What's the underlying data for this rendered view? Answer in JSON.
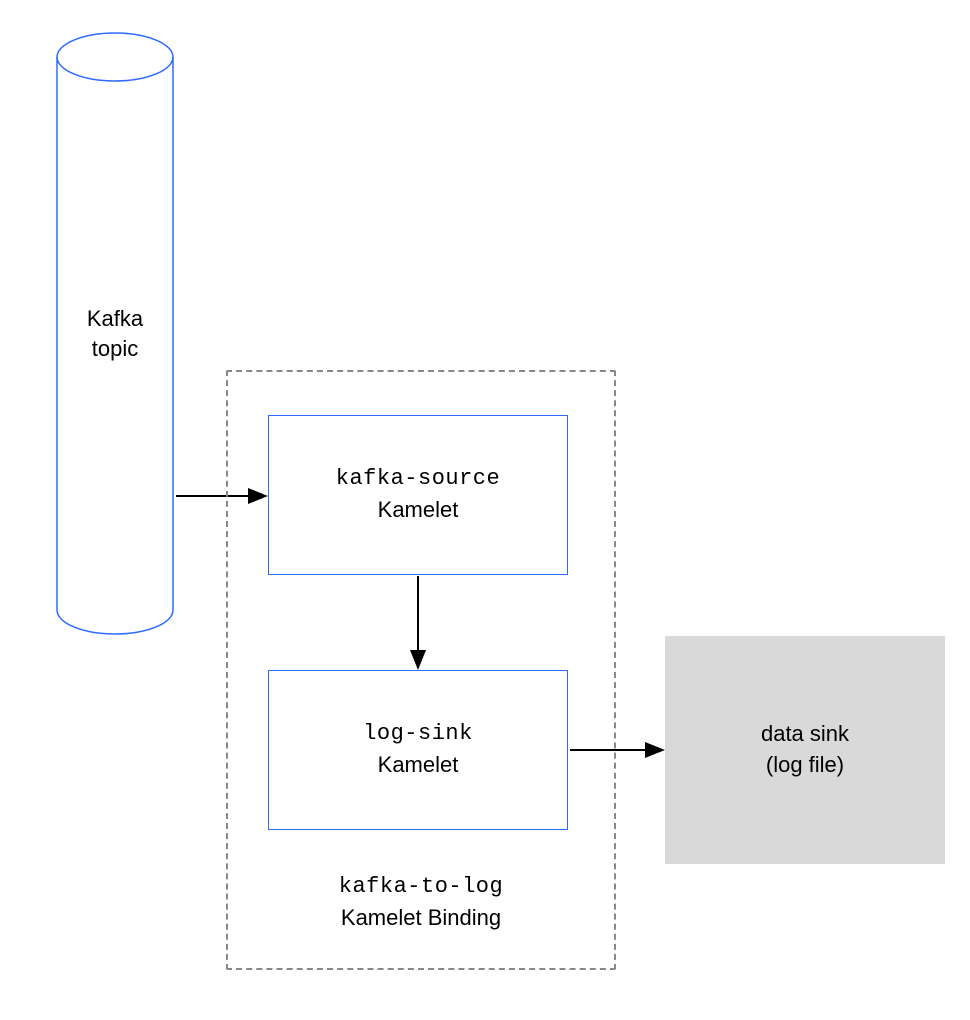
{
  "cylinder": {
    "line1": "Kafka",
    "line2": "topic",
    "stroke": "#2d6bff"
  },
  "binding": {
    "dashed_box_label_line1": "kafka-to-log",
    "dashed_box_label_line2": "Kamelet Binding",
    "source": {
      "line1": "kafka-source",
      "line2": "Kamelet"
    },
    "sink": {
      "line1": "log-sink",
      "line2": "Kamelet"
    },
    "border": "#2d6bff"
  },
  "data_sink": {
    "line1": "data sink",
    "line2": "(log file)",
    "bg": "#d9d9d9"
  },
  "arrows": {
    "color": "#000000"
  }
}
